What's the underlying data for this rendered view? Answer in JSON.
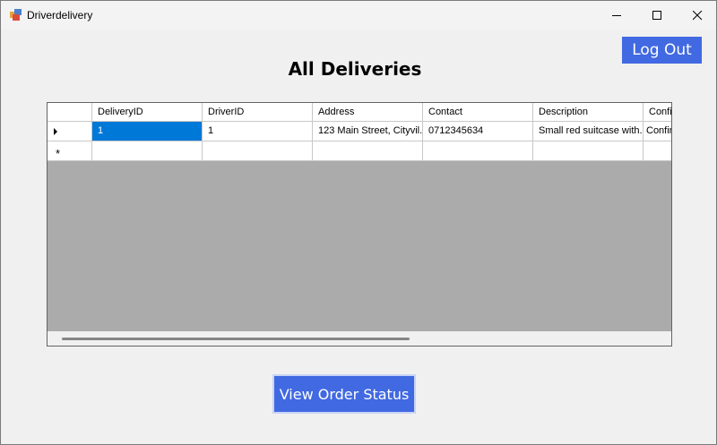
{
  "window": {
    "title": "Driverdelivery"
  },
  "header": {
    "logout_label": "Log Out",
    "heading": "All Deliveries"
  },
  "grid": {
    "columns": [
      "DeliveryID",
      "DriverID",
      "Address",
      "Contact",
      "Description",
      "Confi"
    ],
    "rows": [
      [
        "1",
        "1",
        "123 Main Street, Cityvil...",
        "0712345634",
        "Small red suitcase with...",
        "Confirm"
      ]
    ],
    "new_row_marker": "*"
  },
  "footer": {
    "view_status_label": "View Order Status"
  },
  "colors": {
    "accent": "#4169e1",
    "selection": "#0078d7",
    "grid_bg": "#ababab"
  }
}
